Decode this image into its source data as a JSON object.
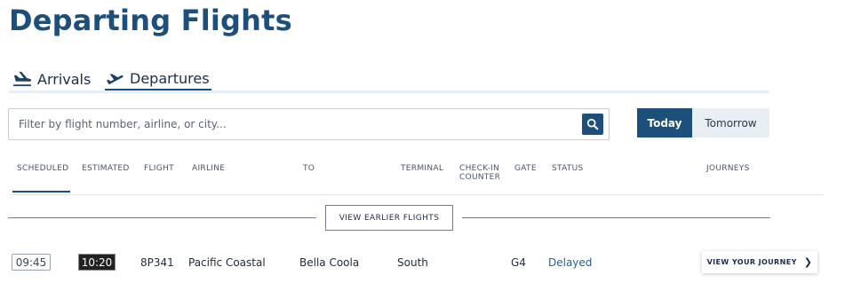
{
  "page": {
    "title": "Departing Flights"
  },
  "tabs": [
    {
      "label": "Arrivals",
      "icon": "plane-landing-icon"
    },
    {
      "label": "Departures",
      "icon": "plane-takeoff-icon",
      "active": true
    }
  ],
  "search": {
    "placeholder": "Filter by flight number, airline, or city...",
    "value": ""
  },
  "day_toggle": {
    "today": "Today",
    "tomorrow": "Tomorrow",
    "selected": "Today"
  },
  "columns": {
    "scheduled": "SCHEDULED",
    "estimated": "ESTIMATED",
    "flight": "FLIGHT",
    "airline": "AIRLINE",
    "to": "TO",
    "terminal": "TERMINAL",
    "checkin": "CHECK-IN COUNTER",
    "gate": "GATE",
    "status": "STATUS",
    "journeys": "JOURNEYS"
  },
  "earlier_button": "VIEW EARLIER FLIGHTS",
  "flights": [
    {
      "scheduled": "09:45",
      "estimated": "10:20",
      "flight": "8P341",
      "airline": "Pacific Coastal",
      "to": "Bella Coola",
      "terminal": "South",
      "checkin": "",
      "gate": "G4",
      "status": "Delayed",
      "journey_button": "VIEW YOUR JOURNEY"
    }
  ],
  "colors": {
    "brand": "#1d4f7c",
    "status_delayed": "#2a5f8f"
  }
}
